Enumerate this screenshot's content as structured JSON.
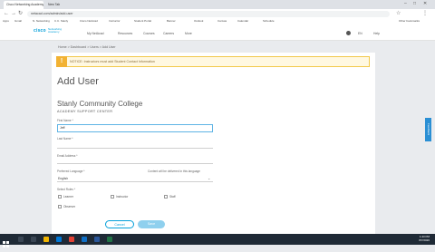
{
  "browser": {
    "tabs": [
      "Cisco Networking Academy - Add User",
      "New Tab"
    ],
    "url": "netacad.com/admin/add-user",
    "bookmarks": [
      "Apps",
      "Gmail",
      "N. Networking",
      "C.C. Stanly",
      "Cisco NetAcad",
      "Instructor",
      "Student Portal",
      "Banner",
      "Outlook",
      "Canvas",
      "Calendar",
      "Schedule",
      "Other bookmarks"
    ]
  },
  "header": {
    "logo": "cisco",
    "logo_sub": "Networking Academy",
    "nav": [
      "My NetAcad",
      "Resources",
      "Courses",
      "Careers",
      "More"
    ],
    "user": "Help",
    "lang": "EN"
  },
  "breadcrumb": "Home > Dashboard > Users > Add User",
  "warning": "NOTICE: Instructors must add Student Contact Information",
  "page_title": "Add User",
  "org_name": "Stanly Community College",
  "org_subtitle": "ACADEMY SUPPORT CENTER",
  "form": {
    "first_name_label": "First Name *",
    "first_name_value": "Jeff",
    "last_name_label": "Last Name *",
    "email_label": "Email Address *",
    "language_label": "Preferred Language *",
    "language_note": "Content will be delivered in this language",
    "language_value": "English",
    "roles_label": "Select Roles *",
    "roles": [
      "Learner",
      "Instructor",
      "Staff",
      "Observer"
    ],
    "cancel_label": "Cancel",
    "save_label": "Save"
  },
  "feedback_label": "Feedback",
  "taskbar": {
    "time": "1:43 PM",
    "date": "8/7/2020"
  },
  "colors": {
    "brand": "#049fd9",
    "warning": "#f2b233",
    "taskbar": "#1f2a36"
  }
}
